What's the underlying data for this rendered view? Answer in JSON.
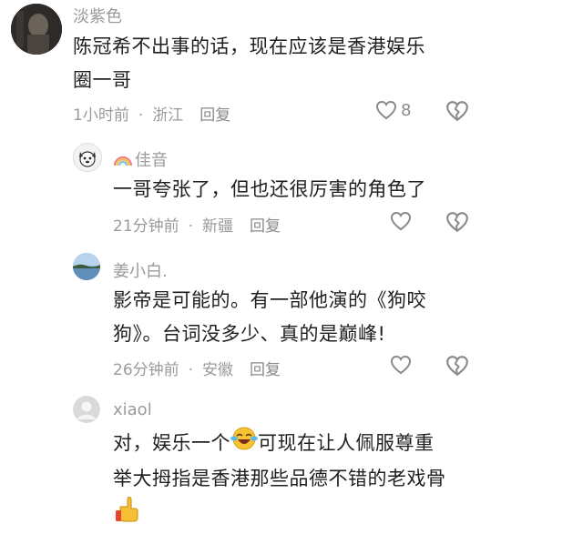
{
  "comments": [
    {
      "username": "淡紫色",
      "text_lines": [
        "陈冠希不出事的话，现在应该是香港娱乐",
        "圈一哥"
      ],
      "time": "1小时前",
      "location": "浙江",
      "reply_label": "回复",
      "like_count": "8"
    },
    {
      "username": "佳音",
      "text_lines": [
        "一哥夸张了，但也还很厉害的角色了"
      ],
      "time": "21分钟前",
      "location": "新疆",
      "reply_label": "回复"
    },
    {
      "username": "姜小白.",
      "text_lines": [
        "影帝是可能的。有一部他演的《狗咬",
        "狗》。台词没多少、真的是巅峰!"
      ],
      "time": "26分钟前",
      "location": "安徽",
      "reply_label": "回复"
    },
    {
      "username": "xiaol",
      "text_line1_before": "对，娱乐一个",
      "text_line1_after": "可现在让人佩服尊重",
      "text_line2": "举大拇指是香港那些品德不错的老戏骨"
    }
  ],
  "colors": {
    "meta_gray": "#9a9a9a",
    "icon_gray": "#8a8a8a",
    "text_dark": "#1f1f1f"
  }
}
